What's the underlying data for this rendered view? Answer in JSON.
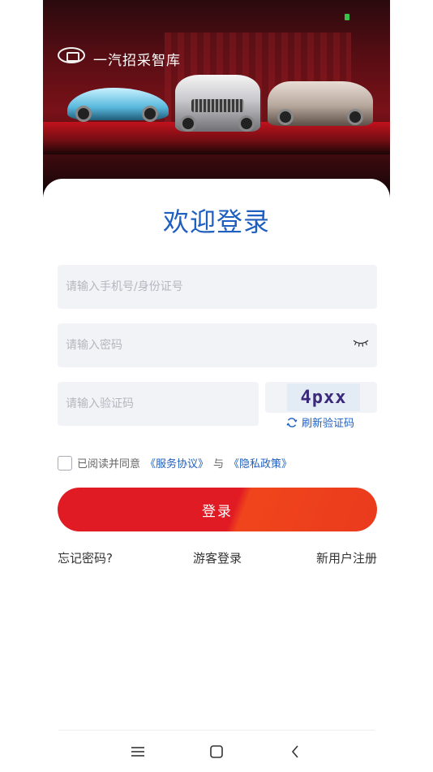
{
  "banner": {
    "brand_title": "一汽招采智库"
  },
  "login": {
    "title": "欢迎登录",
    "phone_placeholder": "请输入手机号/身份证号",
    "password_placeholder": "请输入密码",
    "captcha_placeholder": "请输入验证码",
    "captcha_text": "4pxx",
    "refresh_label": "刷新验证码",
    "agreement": {
      "prefix": "已阅读并同意",
      "service_link": "《服务协议》",
      "connector": "与",
      "privacy_link": "《隐私政策》"
    },
    "submit_label": "登录",
    "forgot_label": "忘记密码?",
    "guest_label": "游客登录",
    "register_label": "新用户注册"
  },
  "colors": {
    "accent_blue": "#1f5fbf",
    "button_red": "#e01b24",
    "field_bg": "#f2f3f7"
  },
  "icons": {
    "password_toggle": "eye-closed-icon",
    "refresh": "refresh-icon",
    "nav_menu": "menu-icon",
    "nav_home": "home-icon",
    "nav_back": "back-icon"
  }
}
